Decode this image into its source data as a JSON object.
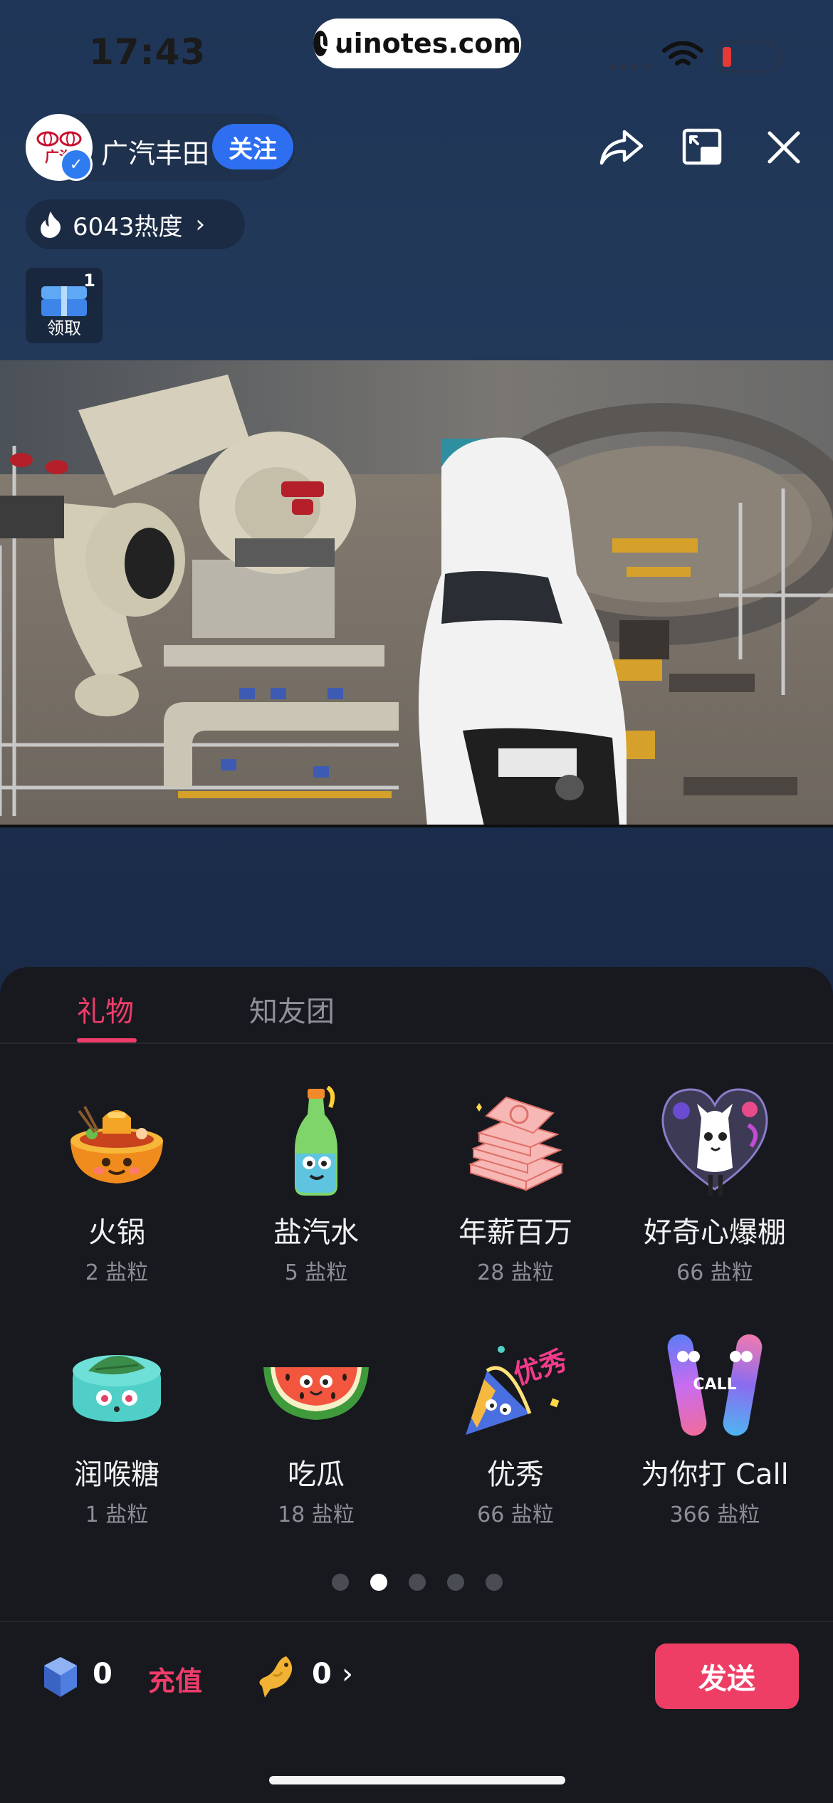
{
  "status_bar": {
    "time": "17:43",
    "url": "uinotes.com"
  },
  "host": {
    "name": "广汽丰田",
    "follow_label": "关注",
    "logo_text": "广汽"
  },
  "heat": {
    "value_label": "6043热度",
    "arrow": "›"
  },
  "gift_box": {
    "badge": "1",
    "label": "领取"
  },
  "top_icons": [
    "share-icon",
    "pip-icon",
    "close-icon"
  ],
  "tabs": [
    {
      "label": "礼物",
      "active": true
    },
    {
      "label": "知友团",
      "active": false
    }
  ],
  "gifts": [
    {
      "name": "火锅",
      "price": "2 盐粒",
      "icon": "hotpot-icon"
    },
    {
      "name": "盐汽水",
      "price": "5 盐粒",
      "icon": "soda-bottle-icon"
    },
    {
      "name": "年薪百万",
      "price": "28 盐粒",
      "icon": "money-stack-icon"
    },
    {
      "name": "好奇心爆棚",
      "price": "66 盐粒",
      "icon": "curious-heart-icon"
    },
    {
      "name": "润喉糖",
      "price": "1 盐粒",
      "icon": "throat-candy-icon"
    },
    {
      "name": "吃瓜",
      "price": "18 盐粒",
      "icon": "watermelon-icon"
    },
    {
      "name": "优秀",
      "price": "66 盐粒",
      "icon": "party-popper-icon"
    },
    {
      "name": "为你打 Call",
      "price": "366 盐粒",
      "icon": "glow-sticks-icon"
    }
  ],
  "pagination": {
    "count": 5,
    "active_index": 1
  },
  "wallet": {
    "crystal_count": "0",
    "recharge_label": "充值",
    "fish_count": "0",
    "fish_arrow": "›"
  },
  "send_label": "发送",
  "colors": {
    "accent": "#f03c6a",
    "follow_blue": "#2d6ff0",
    "panel_bg": "#17191e"
  }
}
